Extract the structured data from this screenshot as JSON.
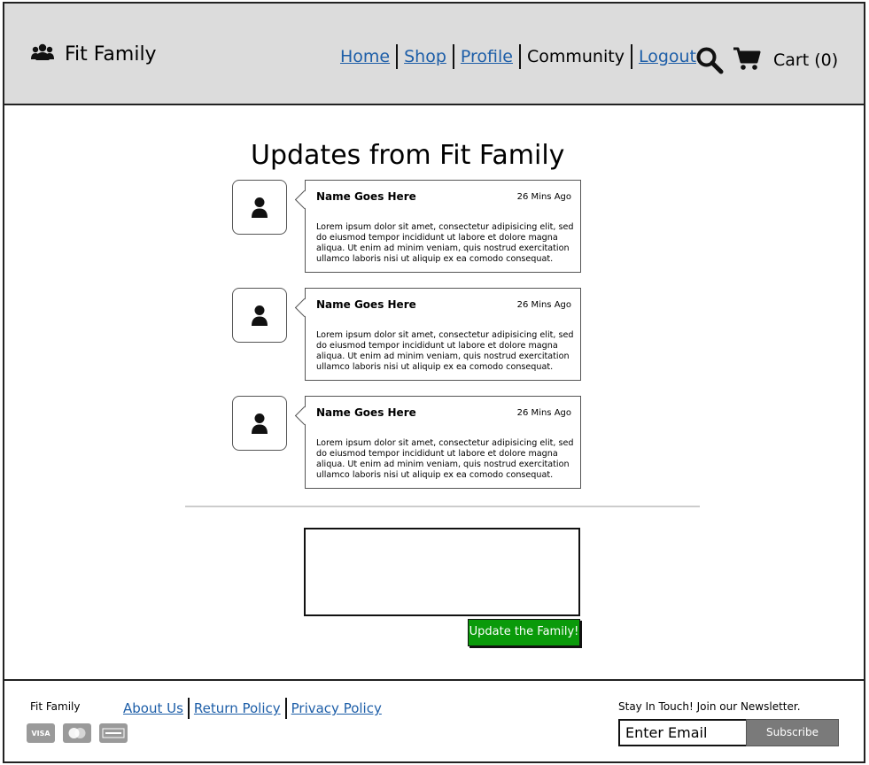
{
  "header": {
    "brand": "Fit Family",
    "nav": [
      {
        "label": "Home",
        "link": true
      },
      {
        "label": "Shop",
        "link": true
      },
      {
        "label": "Profile",
        "link": true
      },
      {
        "label": "Community",
        "link": false
      },
      {
        "label": "Logout",
        "link": true
      }
    ],
    "cart_label": "Cart (0)"
  },
  "main": {
    "title": "Updates from Fit Family",
    "posts": [
      {
        "name": "Name Goes Here",
        "time": "26 Mins Ago",
        "body": "Lorem ipsum dolor sit amet, consectetur adipisicing elit, sed do eiusmod tempor incididunt ut labore et dolore magna aliqua. Ut enim ad minim veniam, quis nostrud exercitation ullamco laboris nisi ut aliquip ex ea comodo consequat."
      },
      {
        "name": "Name Goes Here",
        "time": "26 Mins Ago",
        "body": "Lorem ipsum dolor sit amet, consectetur adipisicing elit, sed do eiusmod tempor incididunt ut labore et dolore magna aliqua. Ut enim ad minim veniam, quis nostrud exercitation ullamco laboris nisi ut aliquip ex ea comodo consequat."
      },
      {
        "name": "Name Goes Here",
        "time": "26 Mins Ago",
        "body": "Lorem ipsum dolor sit amet, consectetur adipisicing elit, sed do eiusmod tempor incididunt ut labore et dolore magna aliqua. Ut enim ad minim veniam, quis nostrud exercitation ullamco laboris nisi ut aliquip ex ea comodo consequat."
      }
    ],
    "composer_value": "",
    "update_button": "Update the Family!"
  },
  "footer": {
    "brand": "Fit Family",
    "links": [
      "About Us",
      "Return Policy",
      "Privacy Policy"
    ],
    "cards": [
      {
        "label": "VISA",
        "icon": "visa-icon"
      },
      {
        "label": "",
        "icon": "mastercard-icon"
      },
      {
        "label": "",
        "icon": "amex-icon"
      }
    ],
    "newsletter_label": "Stay In Touch! Join our Newsletter.",
    "email_placeholder": "Enter Email",
    "subscribe_button": "Subscribe"
  },
  "colors": {
    "header_bg": "#dcdcdc",
    "link": "#1d5ea8",
    "update_button": "#0a9a0a",
    "subscribe_button": "#7a7a7a"
  }
}
